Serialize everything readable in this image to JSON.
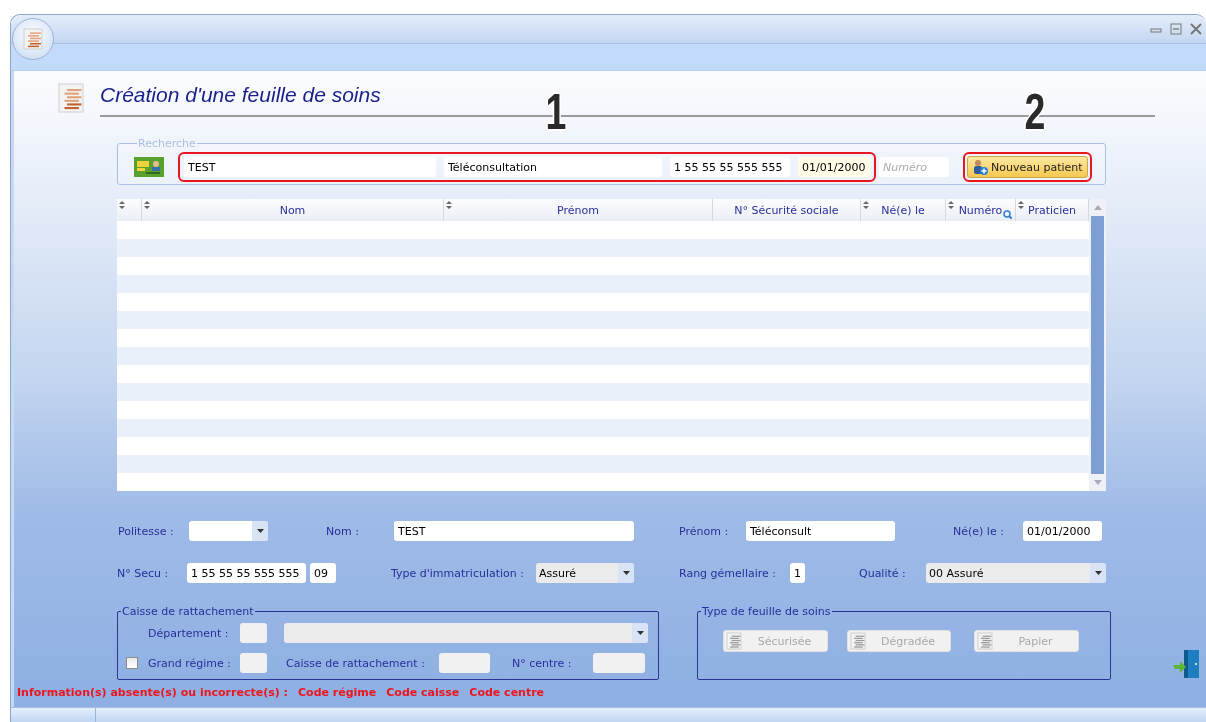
{
  "heading": {
    "title": "Création d'une feuille de soins"
  },
  "search": {
    "legend": "Recherche",
    "fields": [
      {
        "value": "TEST",
        "highlighted": false
      },
      {
        "value": "Téléconsultation",
        "highlighted": false
      },
      {
        "value": "1 55 55 55 555 555",
        "highlighted": false
      },
      {
        "value": "01/01/2000",
        "highlighted": true
      },
      {
        "placeholder": "Numéro",
        "highlighted": false
      }
    ],
    "new_patient_button": "Nouveau patient"
  },
  "annotations": [
    {
      "label": "1"
    },
    {
      "label": "2"
    }
  ],
  "table": {
    "columns": [
      {
        "sortable": true,
        "searchable": false
      },
      {
        "label": "Nom",
        "sortable": true,
        "searchable": false
      },
      {
        "label": "Prénom",
        "sortable": true,
        "searchable": false
      },
      {
        "label": "N° Sécurité sociale",
        "sortable": false,
        "searchable": false
      },
      {
        "label": "Né(e) le",
        "sortable": true,
        "searchable": false
      },
      {
        "label": "Numéro",
        "sortable": true,
        "searchable": true
      },
      {
        "label": "Praticien",
        "sortable": true,
        "searchable": false
      }
    ]
  },
  "patient": {
    "rows": [
      [
        {
          "kind": "select",
          "label": "Politesse :",
          "readonly": false
        },
        {
          "kind": "text",
          "label": "Nom :",
          "value": "TEST",
          "readonly": false
        },
        {
          "kind": "text",
          "label": "Prénom :",
          "value": "Téléconsult",
          "readonly": false
        },
        {
          "kind": "text",
          "label": "Né(e) le :",
          "value": "01/01/2000",
          "readonly": false
        }
      ],
      [
        {
          "kind": "secu",
          "label": "N° Secu :",
          "value": "1 55 55 55 555 555",
          "key": "09",
          "readonly": false
        },
        {
          "kind": "select",
          "label": "Type d'immatriculation :",
          "value": "Assuré",
          "readonly": true
        },
        {
          "kind": "text",
          "label": "Rang gémellaire :",
          "value": "1",
          "readonly": false
        },
        {
          "kind": "select",
          "label": "Qualité :",
          "value": "00 Assuré",
          "readonly": true
        }
      ]
    ]
  },
  "caisse": {
    "legend": "Caisse de rattachement",
    "rows": [
      [
        {
          "kind": "text",
          "label": "Département :",
          "readonly": true
        },
        {
          "kind": "select",
          "readonly": true
        }
      ],
      [
        {
          "kind": "checkbox",
          "checked": false
        },
        {
          "kind": "text",
          "label": "Grand régime :",
          "readonly": true
        },
        {
          "kind": "text",
          "label": "Caisse de rattachement :",
          "readonly": true
        },
        {
          "kind": "text",
          "label": "N° centre :",
          "readonly": true
        }
      ]
    ]
  },
  "sheet_type": {
    "legend": "Type de feuille de soins",
    "buttons": [
      {
        "label": "Sécurisée",
        "disabled": true
      },
      {
        "label": "Dégradée",
        "disabled": true
      },
      {
        "label": "Papier",
        "disabled": true
      }
    ]
  },
  "errors": {
    "message": "Information(s) absente(s) ou incorrecte(s)  :",
    "items": [
      "Code régime",
      "Code caisse",
      "Code centre"
    ]
  }
}
